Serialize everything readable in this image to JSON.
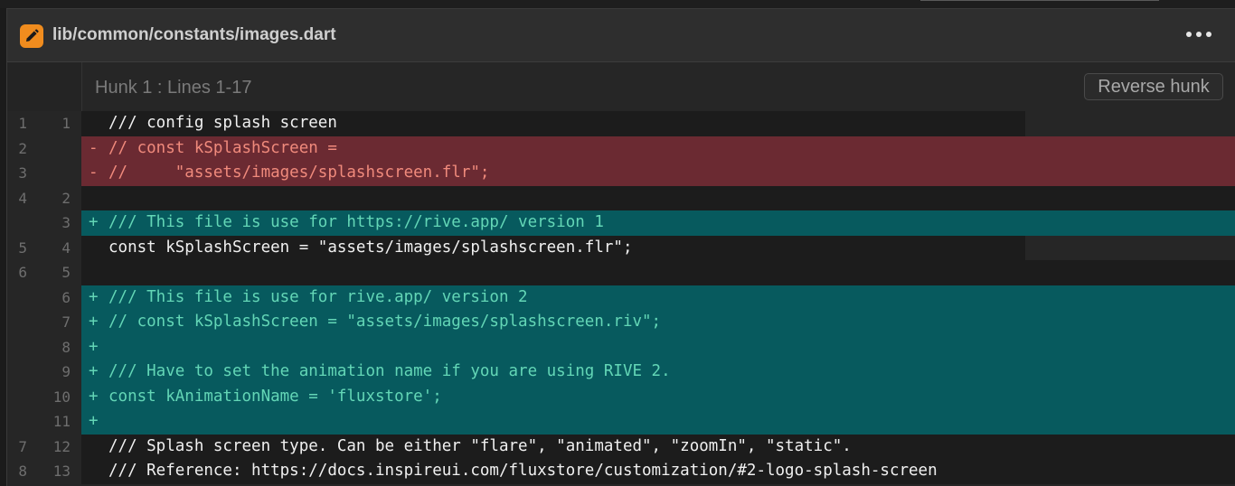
{
  "file": {
    "path": "lib/common/constants/images.dart",
    "icon": "pencil-icon",
    "accent": "#f08c1e"
  },
  "hunk": {
    "title": "Hunk 1 : Lines 1-17",
    "reverse_label": "Reverse hunk"
  },
  "lines": [
    {
      "type": "context",
      "old": "1",
      "new": "1",
      "sign": " ",
      "text": "/// config splash screen"
    },
    {
      "type": "removed",
      "old": "2",
      "new": "",
      "sign": "-",
      "text": "// const kSplashScreen ="
    },
    {
      "type": "removed",
      "old": "3",
      "new": "",
      "sign": "-",
      "text": "//     \"assets/images/splashscreen.flr\";"
    },
    {
      "type": "context",
      "old": "4",
      "new": "2",
      "sign": " ",
      "text": ""
    },
    {
      "type": "added",
      "old": "",
      "new": "3",
      "sign": "+",
      "text": "/// This file is use for https://rive.app/ version 1"
    },
    {
      "type": "context",
      "old": "5",
      "new": "4",
      "sign": " ",
      "text": "const kSplashScreen = \"assets/images/splashscreen.flr\";"
    },
    {
      "type": "context",
      "old": "6",
      "new": "5",
      "sign": " ",
      "text": ""
    },
    {
      "type": "added",
      "old": "",
      "new": "6",
      "sign": "+",
      "text": "/// This file is use for rive.app/ version 2"
    },
    {
      "type": "added",
      "old": "",
      "new": "7",
      "sign": "+",
      "text": "// const kSplashScreen = \"assets/images/splashscreen.riv\";"
    },
    {
      "type": "added",
      "old": "",
      "new": "8",
      "sign": "+",
      "text": ""
    },
    {
      "type": "added",
      "old": "",
      "new": "9",
      "sign": "+",
      "text": "/// Have to set the animation name if you are using RIVE 2."
    },
    {
      "type": "added",
      "old": "",
      "new": "10",
      "sign": "+",
      "text": "const kAnimationName = 'fluxstore';"
    },
    {
      "type": "added",
      "old": "",
      "new": "11",
      "sign": "+",
      "text": ""
    },
    {
      "type": "context",
      "old": "7",
      "new": "12",
      "sign": " ",
      "text": "/// Splash screen type. Can be either \"flare\", \"animated\", \"zoomIn\", \"static\"."
    },
    {
      "type": "context",
      "old": "8",
      "new": "13",
      "sign": " ",
      "text": "/// Reference: https://docs.inspireui.com/fluxstore/customization/#2-logo-splash-screen"
    }
  ]
}
